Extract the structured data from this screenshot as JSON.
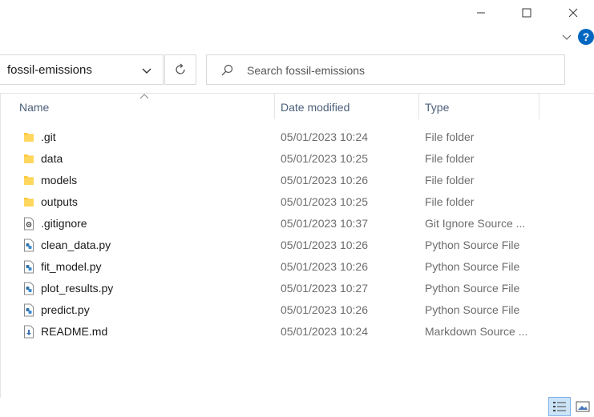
{
  "window": {
    "minimize_icon": "minimize-icon",
    "maximize_icon": "maximize-icon",
    "close_icon": "close-icon"
  },
  "ribbon": {
    "toggle_icon": "chevron-down-icon",
    "help_label": "?"
  },
  "address": {
    "path": "fossil-emissions"
  },
  "search": {
    "placeholder": "Search fossil-emissions"
  },
  "columns": {
    "name": "Name",
    "date": "Date modified",
    "type": "Type"
  },
  "files": [
    {
      "name": ".git",
      "date": "05/01/2023 10:24",
      "type": "File folder",
      "icon": "folder-icon"
    },
    {
      "name": "data",
      "date": "05/01/2023 10:25",
      "type": "File folder",
      "icon": "folder-icon"
    },
    {
      "name": "models",
      "date": "05/01/2023 10:26",
      "type": "File folder",
      "icon": "folder-icon"
    },
    {
      "name": "outputs",
      "date": "05/01/2023 10:25",
      "type": "File folder",
      "icon": "folder-icon"
    },
    {
      "name": ".gitignore",
      "date": "05/01/2023 10:37",
      "type": "Git Ignore Source ...",
      "icon": "config-file-icon"
    },
    {
      "name": "clean_data.py",
      "date": "05/01/2023 10:26",
      "type": "Python Source File",
      "icon": "python-file-icon"
    },
    {
      "name": "fit_model.py",
      "date": "05/01/2023 10:26",
      "type": "Python Source File",
      "icon": "python-file-icon"
    },
    {
      "name": "plot_results.py",
      "date": "05/01/2023 10:27",
      "type": "Python Source File",
      "icon": "python-file-icon"
    },
    {
      "name": "predict.py",
      "date": "05/01/2023 10:26",
      "type": "Python Source File",
      "icon": "python-file-icon"
    },
    {
      "name": "README.md",
      "date": "05/01/2023 10:24",
      "type": "Markdown Source ...",
      "icon": "markdown-file-icon"
    }
  ],
  "colors": {
    "folder": "#ffc83d",
    "accent": "#0067c0",
    "header_text": "#4c607a"
  }
}
